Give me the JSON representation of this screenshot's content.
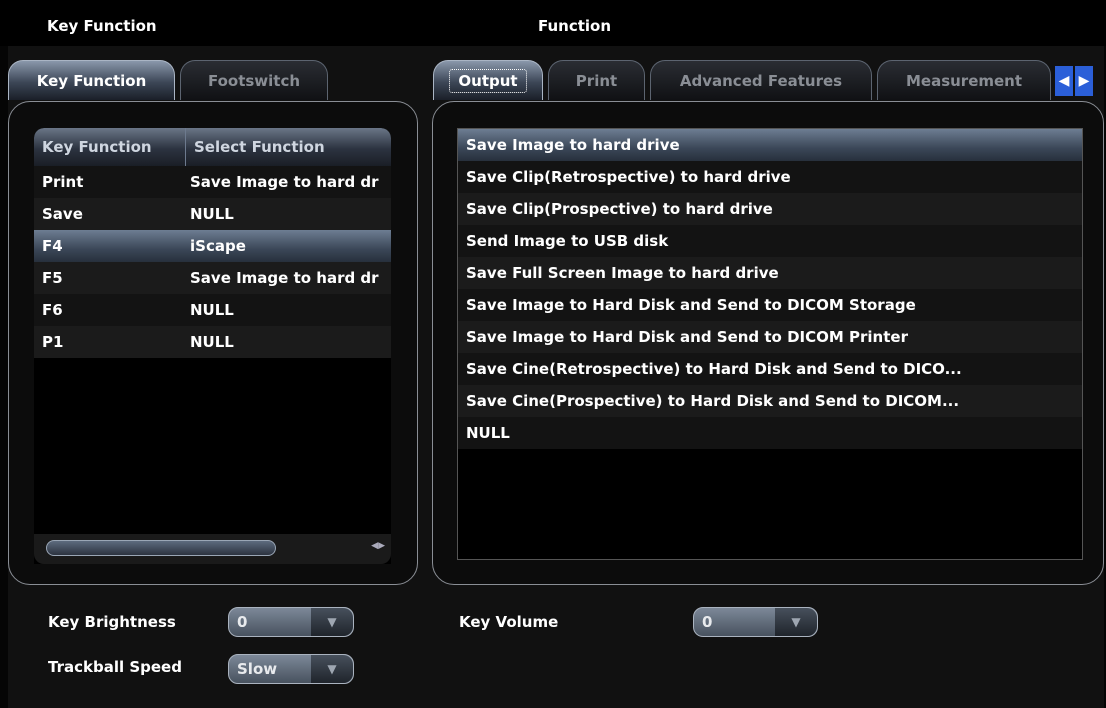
{
  "header": {
    "left_title": "Key Function",
    "right_title": "Function"
  },
  "left_tabs": [
    {
      "label": "Key Function",
      "active": true
    },
    {
      "label": "Footswitch",
      "active": false
    }
  ],
  "left_table": {
    "headers": [
      "Key Function",
      "Select Function"
    ],
    "rows": [
      {
        "key": "Print",
        "func": "Save Image to hard dr",
        "selected": false
      },
      {
        "key": "Save",
        "func": "NULL",
        "selected": false
      },
      {
        "key": "F4",
        "func": "iScape",
        "selected": true
      },
      {
        "key": "F5",
        "func": "Save Image to hard dr",
        "selected": false
      },
      {
        "key": "F6",
        "func": "NULL",
        "selected": false
      },
      {
        "key": "P1",
        "func": "NULL",
        "selected": false
      }
    ]
  },
  "right_tabs": [
    {
      "label": "Output",
      "active": true
    },
    {
      "label": "Print",
      "active": false
    },
    {
      "label": "Advanced Features",
      "active": false
    },
    {
      "label": "Measurement",
      "active": false
    }
  ],
  "nav_arrows": {
    "left": "◀",
    "right": "▶"
  },
  "function_list": [
    {
      "label": "Save Image to hard drive",
      "selected": true
    },
    {
      "label": "Save Clip(Retrospective) to hard drive"
    },
    {
      "label": "Save Clip(Prospective) to hard drive"
    },
    {
      "label": "Send Image to USB disk"
    },
    {
      "label": "Save Full Screen Image to hard drive"
    },
    {
      "label": "Save Image to Hard Disk and Send to DICOM Storage"
    },
    {
      "label": "Save Image to Hard Disk and Send to DICOM Printer"
    },
    {
      "label": "Save Cine(Retrospective) to Hard Disk and Send to DICO..."
    },
    {
      "label": "Save Cine(Prospective)  to Hard Disk and Send to DICOM..."
    },
    {
      "label": "NULL"
    }
  ],
  "controls": {
    "key_brightness": {
      "label": "Key Brightness",
      "value": "0"
    },
    "trackball_speed": {
      "label": "Trackball Speed",
      "value": "Slow"
    },
    "key_volume": {
      "label": "Key Volume",
      "value": "0"
    }
  }
}
